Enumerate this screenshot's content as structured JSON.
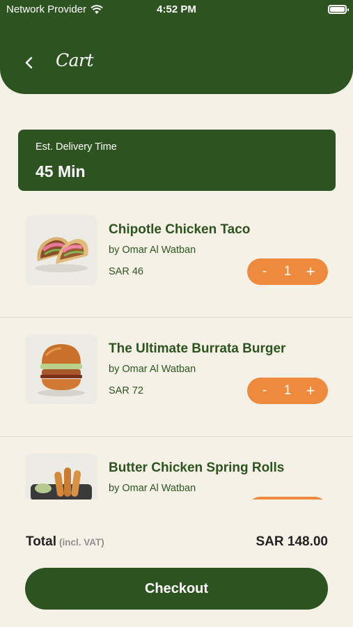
{
  "status_bar": {
    "carrier": "Network Provider",
    "time": "4:52 PM"
  },
  "header": {
    "title": "Cart"
  },
  "delivery": {
    "label": "Est. Delivery Time",
    "value": "45 Min"
  },
  "cart": {
    "items": [
      {
        "name": "Chipotle Chicken Taco",
        "by": "by Omar Al Watban",
        "price": "SAR 46",
        "qty": "1",
        "image": "taco-image"
      },
      {
        "name": "The Ultimate Burrata Burger",
        "by": "by Omar Al Watban",
        "price": "SAR 72",
        "qty": "1",
        "image": "burger-image"
      },
      {
        "name": "Butter Chicken Spring Rolls",
        "by": "by Omar Al Watban",
        "price": "",
        "qty": "",
        "image": "spring-rolls-image"
      }
    ],
    "stepper": {
      "minus": "-",
      "plus": "+"
    }
  },
  "total": {
    "label": "Total",
    "note": "(incl. VAT)",
    "value": "SAR 148.00"
  },
  "checkout": {
    "label": "Checkout"
  },
  "colors": {
    "primary": "#2d5420",
    "accent": "#ee8a3d",
    "background": "#f5f1e6"
  }
}
